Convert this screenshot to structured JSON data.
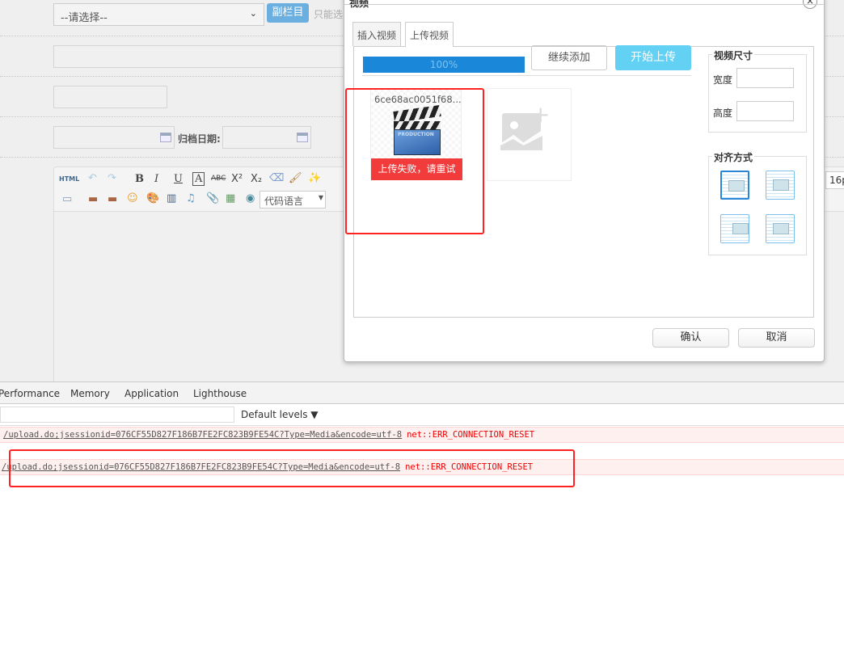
{
  "form": {
    "category_select": "--请选择--",
    "sub_column_button": "副栏目",
    "hint": "只能选",
    "archive_date_label": "归档日期:",
    "code_language_select": "代码语言",
    "font_size_partial": "16p"
  },
  "dialog": {
    "title": "视频",
    "close": "×",
    "tabs": [
      "插入视频",
      "上传视频"
    ],
    "progress_percent": 100,
    "progress_label": "100%",
    "continue_add": "继续添加",
    "start_upload": "开始上传",
    "file": {
      "name": "6ce68ac0051f68...",
      "status": "上传失败，请重试",
      "clapper_text": "PRODUCTION"
    },
    "size_group": {
      "legend": "视频尺寸",
      "width_label": "宽度",
      "height_label": "高度",
      "width_value": "",
      "height_value": ""
    },
    "align_group": {
      "legend": "对齐方式"
    },
    "confirm": "确认",
    "cancel": "取消"
  },
  "devtools": {
    "tabs": [
      "Performance",
      "Memory",
      "Application",
      "Lighthouse"
    ],
    "filter_value": "",
    "levels": "Default levels ▼",
    "errors": [
      {
        "url": "/upload.do;jsessionid=076CF55D827F186B7FE2FC823B9FE54C?Type=Media&encode=utf-8",
        "msg": "net::ERR_CONNECTION_RESET"
      },
      {
        "url": "/upload.do;jsessionid=076CF55D827F186B7FE2FC823B9FE54C?Type=Media&encode=utf-8",
        "msg": "net::ERR_CONNECTION_RESET"
      }
    ]
  },
  "colors": {
    "accent": "#1a87d9",
    "upload_btn": "#63d1f4",
    "error": "#f23c3c",
    "annotation": "#ff2222"
  }
}
